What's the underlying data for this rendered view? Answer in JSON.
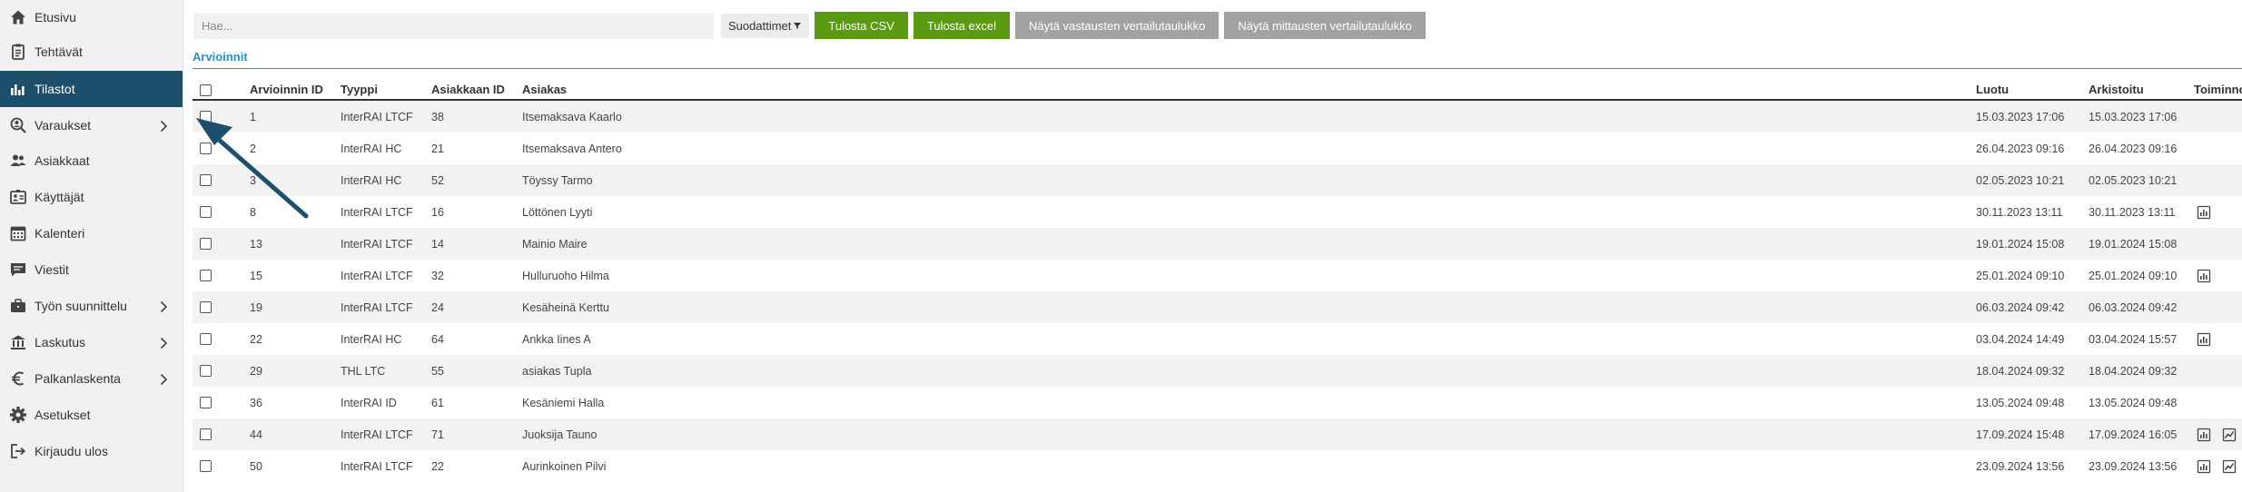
{
  "sidebar": {
    "items": [
      {
        "label": "Etusivu",
        "icon": "home-icon",
        "chevron": false,
        "active": false
      },
      {
        "label": "Tehtävät",
        "icon": "tasks-icon",
        "chevron": false,
        "active": false
      },
      {
        "label": "Tilastot",
        "icon": "stats-icon",
        "chevron": false,
        "active": true
      },
      {
        "label": "Varaukset",
        "icon": "search-person-icon",
        "chevron": true,
        "active": false
      },
      {
        "label": "Asiakkaat",
        "icon": "users-icon",
        "chevron": false,
        "active": false
      },
      {
        "label": "Käyttäjät",
        "icon": "id-card-icon",
        "chevron": false,
        "active": false
      },
      {
        "label": "Kalenteri",
        "icon": "calendar-icon",
        "chevron": false,
        "active": false
      },
      {
        "label": "Viestit",
        "icon": "message-icon",
        "chevron": false,
        "active": false
      },
      {
        "label": "Työn suunnittelu",
        "icon": "briefcase-icon",
        "chevron": true,
        "active": false
      },
      {
        "label": "Laskutus",
        "icon": "bank-icon",
        "chevron": true,
        "active": false
      },
      {
        "label": "Palkanlaskenta",
        "icon": "euro-icon",
        "chevron": true,
        "active": false
      },
      {
        "label": "Asetukset",
        "icon": "gear-icon",
        "chevron": false,
        "active": false
      },
      {
        "label": "Kirjaudu ulos",
        "icon": "logout-icon",
        "chevron": false,
        "active": false
      }
    ]
  },
  "toolbar": {
    "search_placeholder": "Hae...",
    "filter_label": "Suodattimet",
    "btn_csv": "Tulosta CSV",
    "btn_excel": "Tulosta excel",
    "btn_answers": "Näytä vastausten vertailutaulukko",
    "btn_measures": "Näytä mittausten vertailutaulukko"
  },
  "section": {
    "title": "Arvioinnit"
  },
  "table": {
    "headers": {
      "id": "Arvioinnin ID",
      "type": "Tyyppi",
      "customer_id": "Asiakkaan ID",
      "customer": "Asiakas",
      "created": "Luotu",
      "archived": "Arkistoitu",
      "actions": "Toiminnot"
    },
    "rows": [
      {
        "id": "1",
        "type": "InterRAI LTCF",
        "customer_id": "38",
        "customer": "Itsemaksava Kaarlo",
        "created": "15.03.2023 17:06",
        "archived": "15.03.2023 17:06",
        "actions": []
      },
      {
        "id": "2",
        "type": "InterRAI HC",
        "customer_id": "21",
        "customer": "Itsemaksava Antero",
        "created": "26.04.2023 09:16",
        "archived": "26.04.2023 09:16",
        "actions": []
      },
      {
        "id": "3",
        "type": "InterRAI HC",
        "customer_id": "52",
        "customer": "Töyssy Tarmo",
        "created": "02.05.2023 10:21",
        "archived": "02.05.2023 10:21",
        "actions": []
      },
      {
        "id": "8",
        "type": "InterRAI LTCF",
        "customer_id": "16",
        "customer": "Löttönen Lyyti",
        "created": "30.11.2023 13:11",
        "archived": "30.11.2023 13:11",
        "actions": [
          "report-icon"
        ]
      },
      {
        "id": "13",
        "type": "InterRAI LTCF",
        "customer_id": "14",
        "customer": "Mainio Maire",
        "created": "19.01.2024 15:08",
        "archived": "19.01.2024 15:08",
        "actions": []
      },
      {
        "id": "15",
        "type": "InterRAI LTCF",
        "customer_id": "32",
        "customer": "Hulluruoho Hilma",
        "created": "25.01.2024 09:10",
        "archived": "25.01.2024 09:10",
        "actions": [
          "report-icon"
        ]
      },
      {
        "id": "19",
        "type": "InterRAI LTCF",
        "customer_id": "24",
        "customer": "Kesäheinä Kerttu",
        "created": "06.03.2024 09:42",
        "archived": "06.03.2024 09:42",
        "actions": []
      },
      {
        "id": "22",
        "type": "InterRAI HC",
        "customer_id": "64",
        "customer": "Ankka Iines A",
        "created": "03.04.2024 14:49",
        "archived": "03.04.2024 15:57",
        "actions": [
          "report-icon"
        ]
      },
      {
        "id": "29",
        "type": "THL LTC",
        "customer_id": "55",
        "customer": "asiakas Tupla",
        "created": "18.04.2024 09:32",
        "archived": "18.04.2024 09:32",
        "actions": []
      },
      {
        "id": "36",
        "type": "InterRAI ID",
        "customer_id": "61",
        "customer": "Kesäniemi Halla",
        "created": "13.05.2024 09:48",
        "archived": "13.05.2024 09:48",
        "actions": []
      },
      {
        "id": "44",
        "type": "InterRAI LTCF",
        "customer_id": "71",
        "customer": "Juoksija Tauno",
        "created": "17.09.2024 15:48",
        "archived": "17.09.2024 16:05",
        "actions": [
          "report-icon",
          "trend-icon"
        ]
      },
      {
        "id": "50",
        "type": "InterRAI LTCF",
        "customer_id": "22",
        "customer": "Aurinkoinen Pilvi",
        "created": "23.09.2024 13:56",
        "archived": "23.09.2024 13:56",
        "actions": [
          "report-icon",
          "trend-icon"
        ]
      }
    ]
  },
  "colors": {
    "sidebar_active": "#1b4f6b",
    "accent_blue": "#2a8fcf",
    "button_green": "#5a9b12",
    "button_grey": "#a2a2a2",
    "arrow": "#1b4f6b"
  }
}
